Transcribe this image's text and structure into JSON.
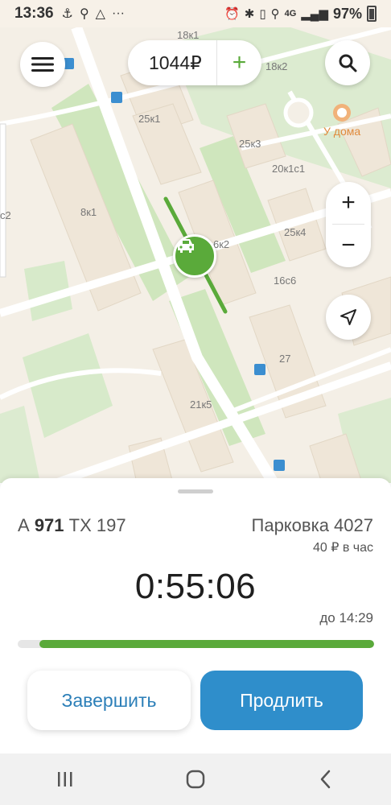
{
  "status_bar": {
    "time": "13:36",
    "network": "4G",
    "battery": "97%"
  },
  "map": {
    "labels": {
      "l_18k1": "18к1",
      "l_18k2": "18к2",
      "l_25k1": "25к1",
      "l_25k3": "25к3",
      "l_20k1s1": "20к1с1",
      "l_8k1": "8к1",
      "l_c2": "с2",
      "l_6k2": "6к2",
      "l_25k4": "25к4",
      "l_16s6": "16с6",
      "l_27": "27",
      "l_21k5": "21к5"
    },
    "poi": "У дома"
  },
  "header": {
    "balance": "1044₽",
    "add_label": "+"
  },
  "zoom": {
    "in": "+",
    "out": "−"
  },
  "parking": {
    "plate_prefix": "А",
    "plate_number": "971",
    "plate_suffix": "ТХ 197",
    "zone": "Парковка 4027",
    "rate": "40 ₽ в час",
    "timer": "0:55:06",
    "until": "до 14:29",
    "progress_remaining_pct": 94
  },
  "actions": {
    "finish": "Завершить",
    "extend": "Продлить"
  },
  "colors": {
    "accent_green": "#5aaa3a",
    "accent_blue": "#2f8ecb",
    "link_blue": "#2c7fb8"
  }
}
